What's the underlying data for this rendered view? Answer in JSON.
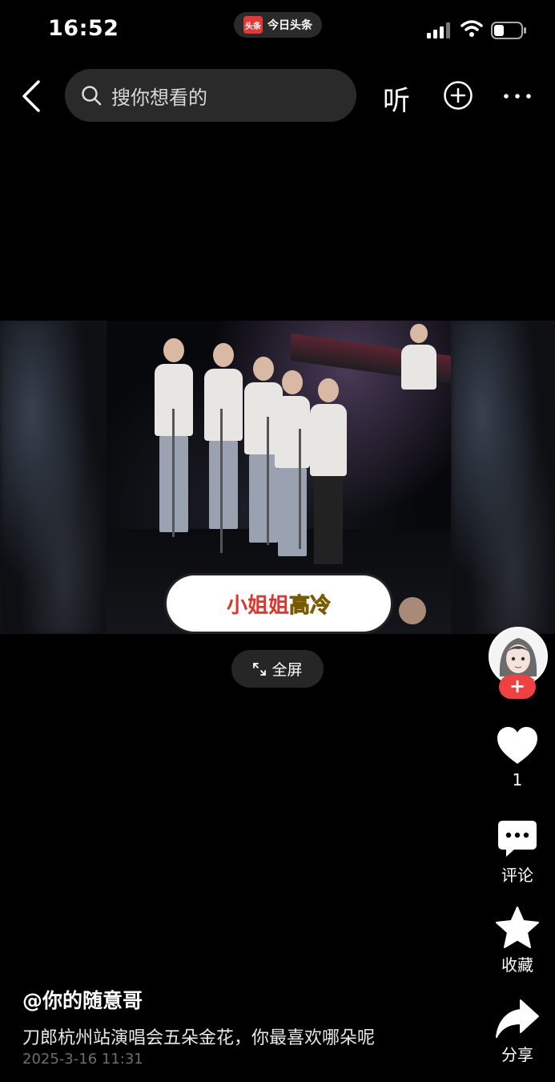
{
  "status_bar": {
    "time": "16:52",
    "app_name": "今日头条",
    "app_logo_text": "头条"
  },
  "top_bar": {
    "search_placeholder": "搜你想看的",
    "listen_label": "听"
  },
  "video": {
    "caption_part1": "小姐姐",
    "caption_part2": "高冷",
    "fullscreen_label": "全屏"
  },
  "right_rail": {
    "follow_symbol": "+",
    "like_count": "1",
    "comment_label": "评论",
    "favorite_label": "收藏",
    "share_label": "分享"
  },
  "info": {
    "author": "@你的随意哥",
    "title": "刀郎杭州站演唱会五朵金花，你最喜欢哪朵呢",
    "publish_time": "2025-3-16 11:31"
  },
  "colors": {
    "accent_red": "#f04142",
    "caption_red": "#e0342c",
    "caption_yellow": "#f2c21b"
  }
}
